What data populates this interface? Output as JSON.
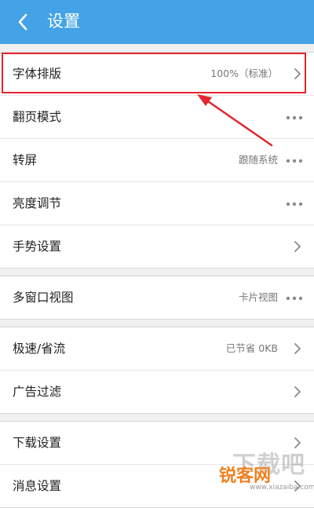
{
  "header": {
    "title": "设置",
    "back_icon": "chevron-left-icon"
  },
  "sections": [
    [
      {
        "label": "字体排版",
        "value": "100%（标准）",
        "accessory": "chevron"
      },
      {
        "label": "翻页模式",
        "value": "",
        "accessory": "dots"
      },
      {
        "label": "转屏",
        "value": "跟随系统",
        "accessory": "dots"
      },
      {
        "label": "亮度调节",
        "value": "",
        "accessory": "dots"
      },
      {
        "label": "手势设置",
        "value": "",
        "accessory": "chevron"
      }
    ],
    [
      {
        "label": "多窗口视图",
        "value": "卡片视图",
        "accessory": "dots"
      }
    ],
    [
      {
        "label": "极速/省流",
        "value": "已节省 0KB",
        "accessory": "chevron"
      },
      {
        "label": "广告过滤",
        "value": "",
        "accessory": "chevron"
      }
    ],
    [
      {
        "label": "下载设置",
        "value": "",
        "accessory": "chevron"
      },
      {
        "label": "消息设置",
        "value": "",
        "accessory": "chevron"
      }
    ]
  ],
  "watermark": {
    "top": "下载吧",
    "brand": "锐客网",
    "url": "www.xiazaiba.com"
  },
  "colors": {
    "header": "#44a3e6",
    "highlight": "#e2252f",
    "background": "#f0f0f0"
  }
}
